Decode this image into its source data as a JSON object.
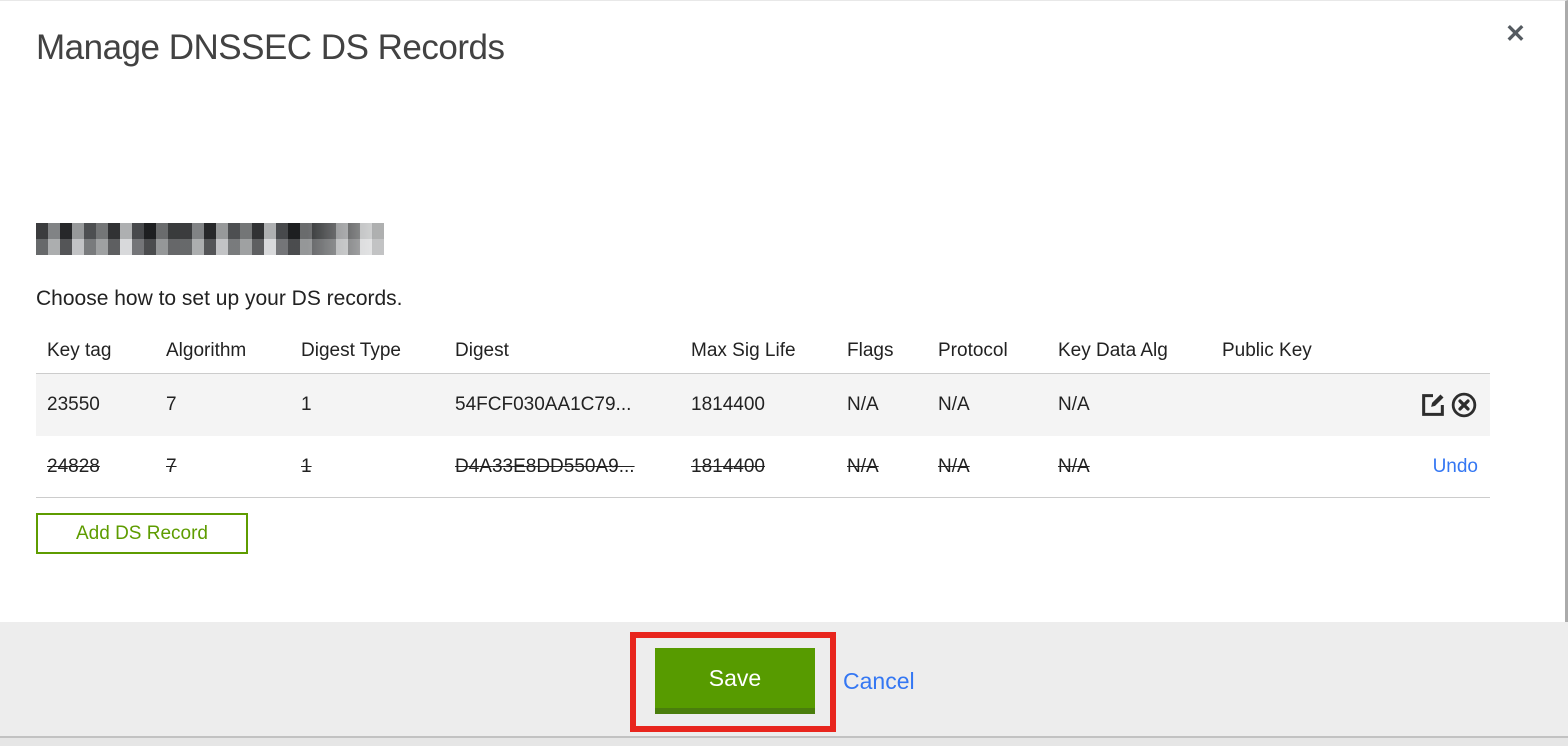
{
  "dialog": {
    "title": "Manage DNSSEC DS Records",
    "close_icon": "✕",
    "instruction": "Choose how to set up your DS records."
  },
  "table": {
    "columns": [
      "Key tag",
      "Algorithm",
      "Digest Type",
      "Digest",
      "Max Sig Life",
      "Flags",
      "Protocol",
      "Key Data Alg",
      "Public Key"
    ],
    "rows": [
      {
        "key_tag": "23550",
        "algorithm": "7",
        "digest_type": "1",
        "digest": "54FCF030AA1C79...",
        "max_sig_life": "1814400",
        "flags": "N/A",
        "protocol": "N/A",
        "key_data_alg": "N/A",
        "public_key": "",
        "state": "active"
      },
      {
        "key_tag": "24828",
        "algorithm": "7",
        "digest_type": "1",
        "digest": "D4A33E8DD550A9...",
        "max_sig_life": "1814400",
        "flags": "N/A",
        "protocol": "N/A",
        "key_data_alg": "N/A",
        "public_key": "",
        "state": "deleted",
        "undo_label": "Undo"
      }
    ],
    "icons": [
      "edit-icon",
      "delete-icon"
    ]
  },
  "buttons": {
    "add_ds_record": "Add DS Record",
    "save": "Save",
    "cancel": "Cancel"
  },
  "colors": {
    "green_button": "#579b00",
    "green_outline": "#5e9c00",
    "link_blue": "#3477f3",
    "annotation_red": "#e8251d",
    "row_shade": "#f4f4f4"
  }
}
